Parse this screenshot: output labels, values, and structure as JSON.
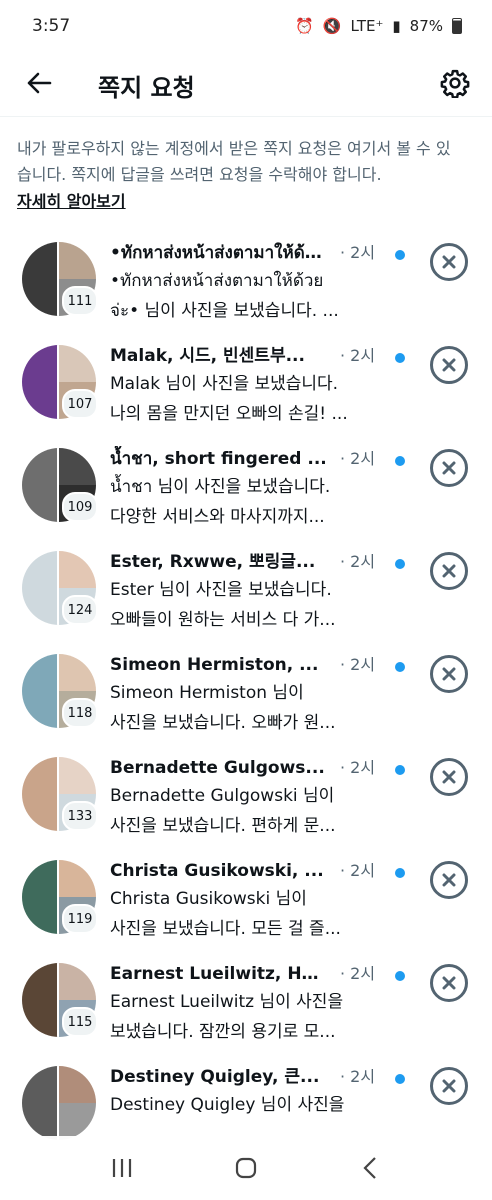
{
  "status": {
    "time": "3:57",
    "network": "LTE⁺",
    "battery": "87%"
  },
  "header": {
    "title": "쪽지 요청"
  },
  "info": {
    "text": "내가 팔로우하지 않는 계정에서 받은 쪽지 요청은 여기서 볼 수 있습니다. 쪽지에 답글을 쓰려면 요청을 수락해야 합니다.",
    "learn_more": "자세히 알아보기"
  },
  "colors": {
    "accent": "#1d9bf0",
    "text": "#0f1419",
    "secondary": "#536471"
  },
  "requests": [
    {
      "name": "•ทักหาส่งหน้าส่งตามาให้ด้วย จ่ะ•, ...",
      "time": "· 2시",
      "line1": "•ทักหาส่งหน้าส่งตามาให้ด้วย",
      "line2": "จ่ะ• 님이 사진을 보냈습니다. ...",
      "count": "111",
      "colors": [
        "#3a3a3a",
        "#b9a38f",
        "#8d8d8d"
      ]
    },
    {
      "name": "Malak, 시드, 빈센트부...",
      "time": "· 2시",
      "line1": "Malak 님이 사진을 보냈습니다.",
      "line2": "나의 몸을 만지던 오빠의 손길! ...",
      "count": "107",
      "colors": [
        "#6b3c8f",
        "#d9c7b8",
        "#c0a690"
      ]
    },
    {
      "name": "น้ำชา, short fingered ...",
      "time": "· 2시",
      "line1": "น้ำชา 님이 사진을 보냈습니다.",
      "line2": "다양한 서비스와 마사지까지...",
      "count": "109",
      "colors": [
        "#6e6e6e",
        "#4a4a4a",
        "#2d2d2d"
      ]
    },
    {
      "name": "Ester, Rxwwe, 뽀링글...",
      "time": "· 2시",
      "line1": "Ester 님이 사진을 보냈습니다.",
      "line2": "오빠들이 원하는 서비스 다 가...",
      "count": "124",
      "colors": [
        "#cfd9de",
        "#e3c7b4",
        "#cfd9de"
      ]
    },
    {
      "name": "Simeon Hermiston, ...",
      "time": "· 2시",
      "line1": "Simeon Hermiston 님이",
      "line2": "사진을 보냈습니다. 오빠가 원...",
      "count": "118",
      "colors": [
        "#7fa8b8",
        "#dec5b0",
        "#b5ad9c"
      ]
    },
    {
      "name": "Bernadette Gulgows...",
      "time": "· 2시",
      "line1": "Bernadette Gulgowski 님이",
      "line2": "사진을 보냈습니다. 편하게 문...",
      "count": "133",
      "colors": [
        "#c9a48a",
        "#e6d3c6",
        "#cfd9de"
      ]
    },
    {
      "name": "Christa Gusikowski, ...",
      "time": "· 2시",
      "line1": "Christa Gusikowski 님이",
      "line2": "사진을 보냈습니다. 모든 걸 즐...",
      "count": "119",
      "colors": [
        "#3f6b5c",
        "#d8b59a",
        "#8b9aa3"
      ]
    },
    {
      "name": "Earnest Lueilwitz, Ho...",
      "time": "· 2시",
      "line1": "Earnest Lueilwitz 님이 사진을",
      "line2": "보냈습니다. 잠깐의 용기로 모...",
      "count": "115",
      "colors": [
        "#5a4636",
        "#c9b3a5",
        "#8fa2b1"
      ]
    },
    {
      "name": "Destiney Quigley, 큰...",
      "time": "· 2시",
      "line1": "Destiney Quigley 님이 사진을",
      "line2": "",
      "count": "",
      "colors": [
        "#5c5c5c",
        "#b08d7a",
        "#9a9a9a"
      ]
    }
  ]
}
